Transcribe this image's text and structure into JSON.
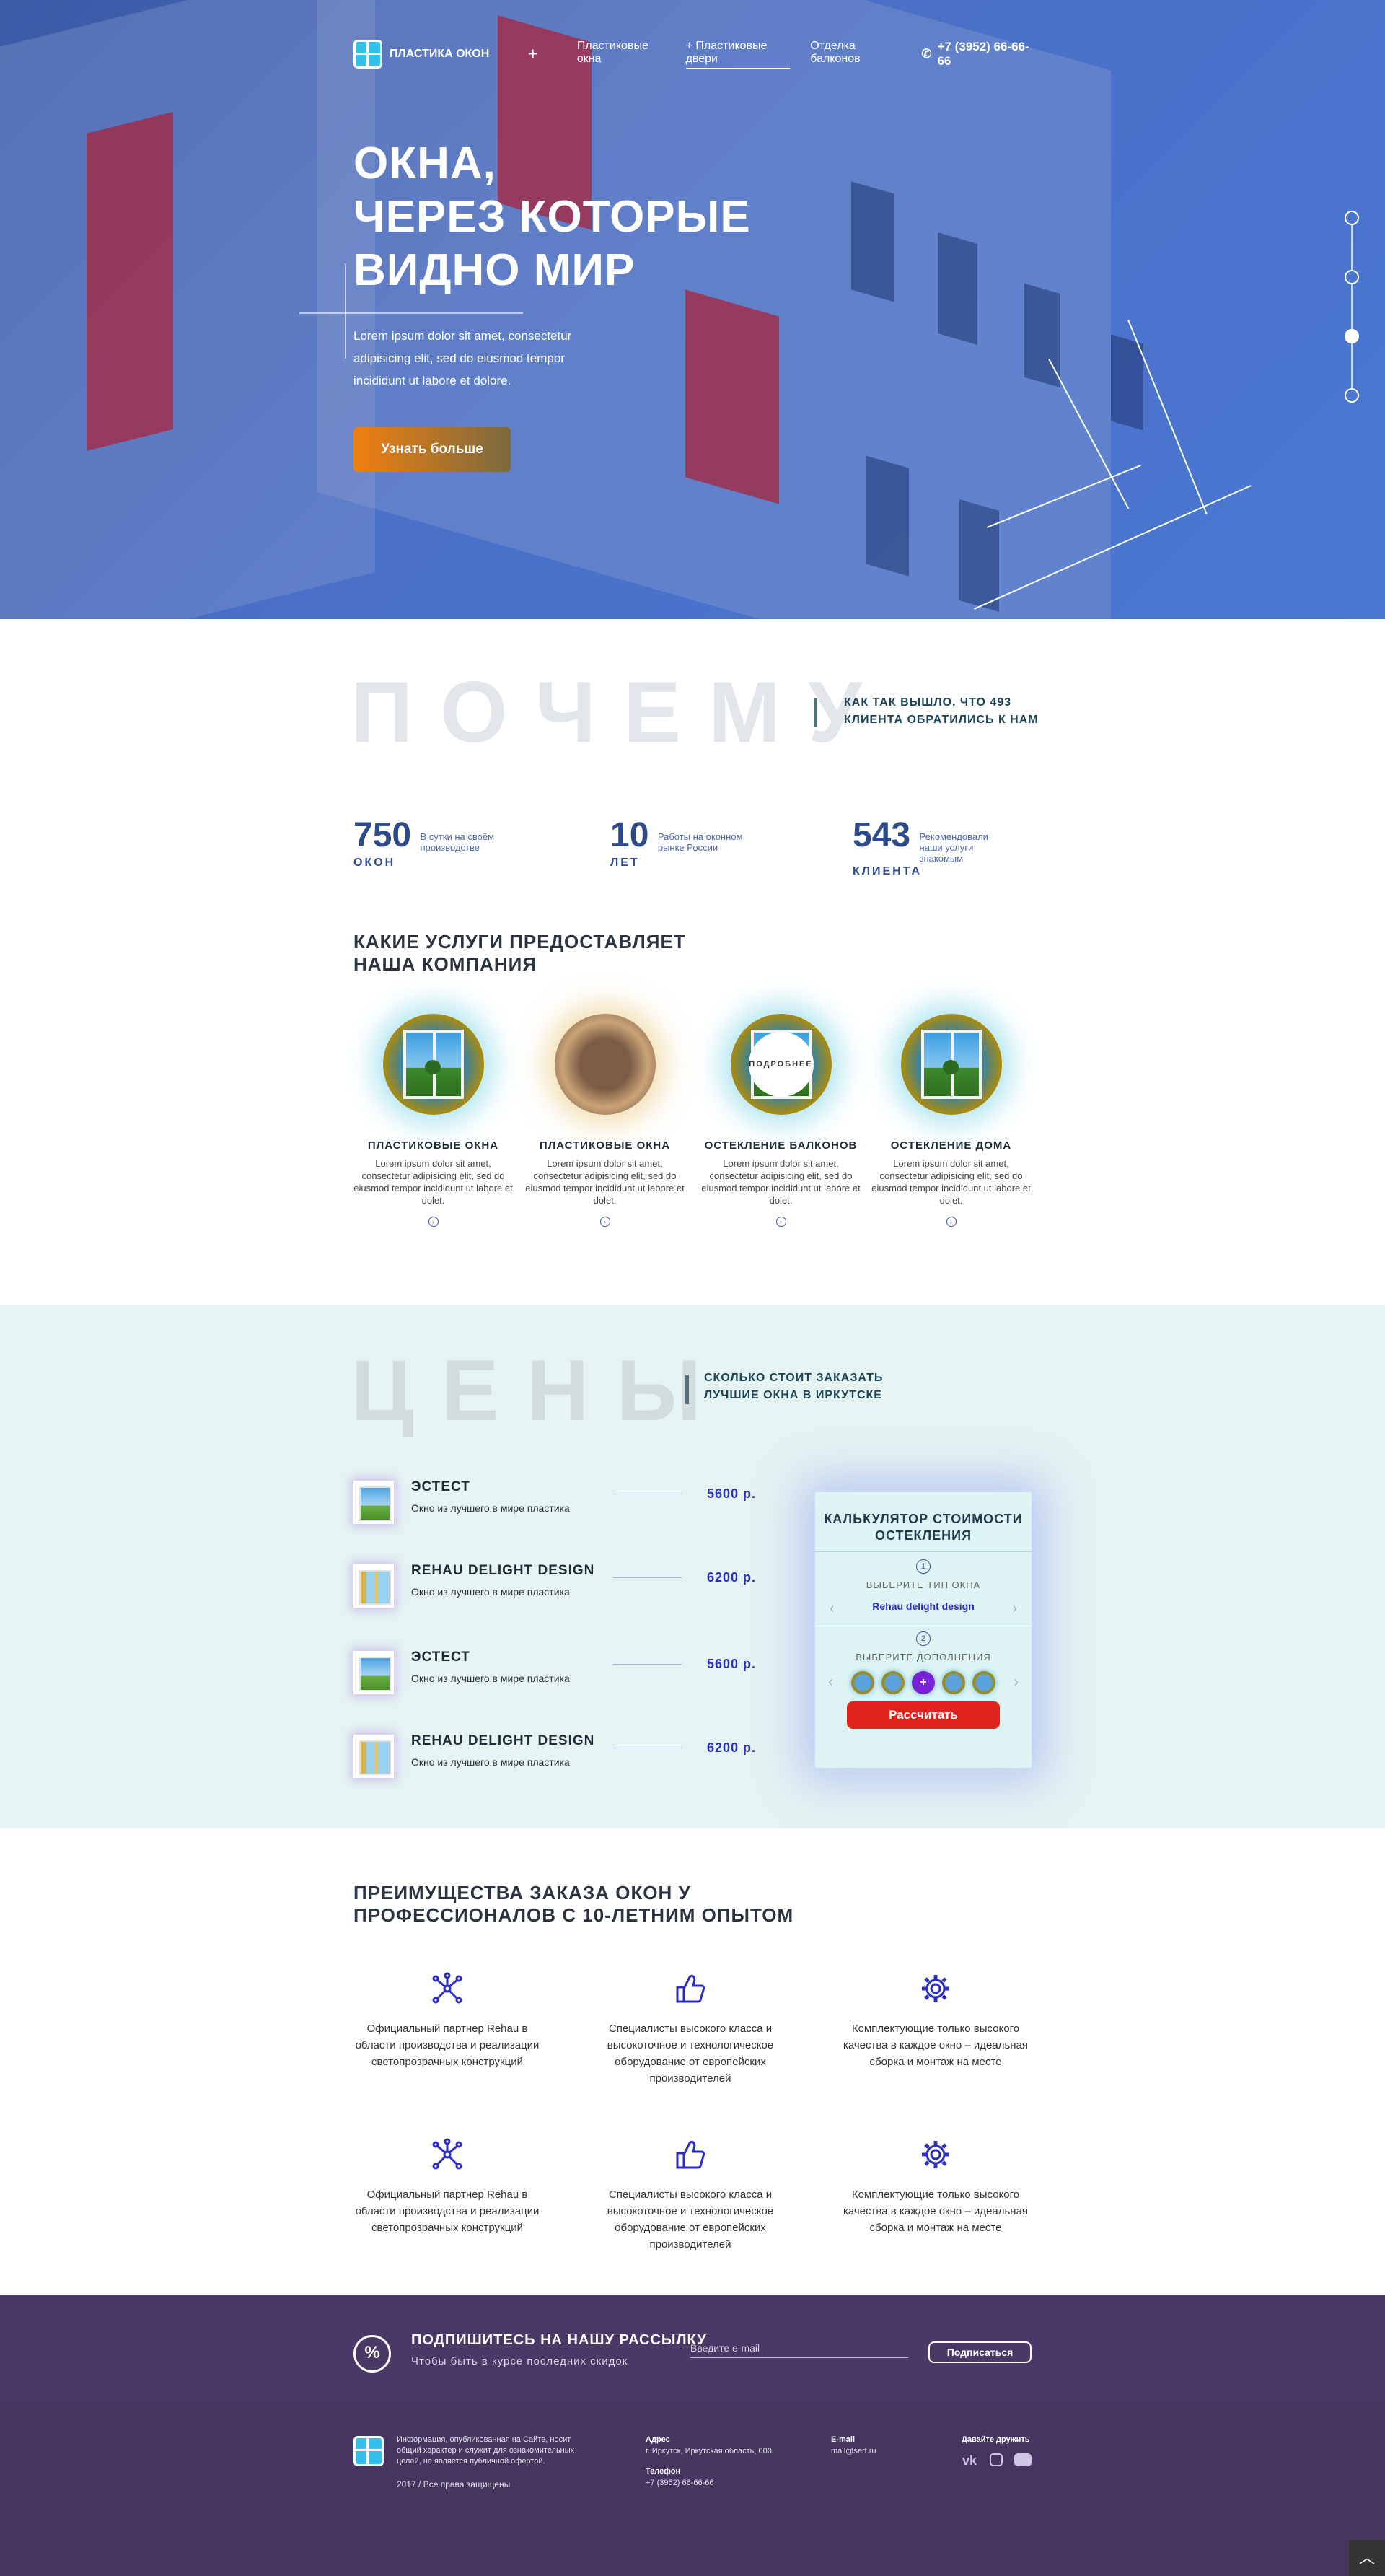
{
  "header": {
    "logo_text": "ПЛАСТИКА ОКОН",
    "plus": "+",
    "nav": [
      "Пластиковые окна",
      "+ Пластиковые двери",
      "Отделка балконов"
    ],
    "phone": "+7 (3952) 66-66-66"
  },
  "hero": {
    "title_l1": "ОКНА,",
    "title_l2": "ЧЕРЕЗ КОТОРЫЕ",
    "title_l3": "ВИДНО МИР",
    "lead": "Lorem ipsum dolor sit amet, consectetur adipisicing elit, sed do eiusmod tempor incididunt ut labore et dolore.",
    "cta": "Узнать больше",
    "slides_total": 4,
    "slide_active": 3
  },
  "why": {
    "big": "ПОЧЕМУ",
    "subtitle_l1": "КАК ТАК ВЫШЛО, ЧТО 493",
    "subtitle_l2": "КЛИЕНТА ОБРАТИЛИСЬ К НАМ",
    "stats": [
      {
        "num": "750",
        "small": "В сутки на своём производстве",
        "label": "ОКОН"
      },
      {
        "num": "10",
        "small": "Работы на оконном рынке России",
        "label": "ЛЕТ"
      },
      {
        "num": "543",
        "small": "Рекомендовали наши услуги знакомым",
        "label": "КЛИЕНТА"
      }
    ]
  },
  "services": {
    "title_l1": "КАКИЕ УСЛУГИ ПРЕДОСТАВЛЯЕТ",
    "title_l2": "НАША КОМПАНИЯ",
    "more": "ПОДРОБНЕЕ",
    "items": [
      {
        "title": "ПЛАСТИКОВЫЕ ОКНА",
        "desc": "Lorem ipsum dolor sit amet, consectetur adipisicing elit, sed do eiusmod tempor incididunt ut labore et dolet."
      },
      {
        "title": "ПЛАСТИКОВЫЕ ОКНА",
        "desc": "Lorem ipsum dolor sit amet, consectetur adipisicing elit, sed do eiusmod tempor incididunt ut labore et dolet."
      },
      {
        "title": "ОСТЕКЛЕНИЕ БАЛКОНОВ",
        "desc": "Lorem ipsum dolor sit amet, consectetur adipisicing elit, sed do eiusmod tempor incididunt ut labore et dolet."
      },
      {
        "title": "ОСТЕКЛЕНИЕ ДОМА",
        "desc": "Lorem ipsum dolor sit amet, consectetur adipisicing elit, sed do eiusmod tempor incididunt ut labore et dolet."
      }
    ]
  },
  "prices": {
    "big": "ЦЕНЫ",
    "subtitle_l1": "СКОЛЬКО СТОИТ ЗАКАЗАТЬ",
    "subtitle_l2": "ЛУЧШИЕ ОКНА В ИРКУТСКЕ",
    "items": [
      {
        "name": "ЭСТЕСТ",
        "desc": "Окно из лучшего в мире пластика",
        "price": "5600 р."
      },
      {
        "name": "REHAU DELIGHT DESIGN",
        "desc": "Окно из лучшего в мире пластика",
        "price": "6200 р."
      },
      {
        "name": "ЭСТЕСТ",
        "desc": "Окно из лучшего в мире пластика",
        "price": "5600 р."
      },
      {
        "name": "REHAU DELIGHT DESIGN",
        "desc": "Окно из лучшего в мире пластика",
        "price": "6200 р."
      }
    ]
  },
  "calc": {
    "title_l1": "КАЛЬКУЛЯТОР СТОИМОСТИ",
    "title_l2": "ОСТЕКЛЕНИЯ",
    "step1": "1",
    "step1_label": "ВЫБЕРИТЕ ТИП ОКНА",
    "step1_value": "Rehau delight design",
    "step2": "2",
    "step2_label": "ВЫБЕРИТЕ ДОПОЛНЕНИЯ",
    "selected_option": "+",
    "button": "Рассчитать"
  },
  "advantages": {
    "title_l1": "ПРЕИМУЩЕСТВА ЗАКАЗА ОКОН У",
    "title_l2": "ПРОФЕССИОНАЛОВ С 10-ЛЕТНИМ ОПЫТОМ",
    "items": [
      {
        "icon": "network-icon",
        "text": "Официальный партнер Rehau в области производства и реализации светопрозрачных конструкций"
      },
      {
        "icon": "thumbs-up-icon",
        "text": "Специалисты высокого класса и высокоточное и технологическое оборудование от европейских производителей"
      },
      {
        "icon": "gear-icon",
        "text": "Комплектующие только высокого качества в каждое окно – идеальная сборка и монтаж на месте"
      },
      {
        "icon": "network-icon",
        "text": "Официальный партнер Rehau в области производства и реализации светопрозрачных конструкций"
      },
      {
        "icon": "thumbs-up-icon",
        "text": "Специалисты высокого класса и высокоточное и технологическое оборудование от европейских производителей"
      },
      {
        "icon": "gear-icon",
        "text": "Комплектующие только высокого качества в каждое окно – идеальная сборка и монтаж на месте"
      }
    ]
  },
  "subscribe": {
    "title": "ПОДПИШИТЕСЬ НА НАШУ РАССЫЛКУ",
    "subtitle": "Чтобы быть в курсе последних скидок",
    "placeholder": "Введите e-mail",
    "button": "Подписаться"
  },
  "footer": {
    "info": "Информация, опубликованная на Сайте, носит общий характер и служит для ознакомительных целей, не является публичной офертой.",
    "copy": "2017 / Все права защищены",
    "address_label": "Адрес",
    "address": "г. Иркутск, Иркутская область, 000",
    "phone_label": "Телефон",
    "phone": "+7 (3952) 66-66-66",
    "email_label": "E-mail",
    "email": "mail@sert.ru",
    "social_label": "Давайте дружить",
    "social": [
      "vk-icon",
      "instagram-icon",
      "youtube-icon"
    ]
  },
  "colors": {
    "accent": "#2a2fc0",
    "cta": "#f07f10",
    "calc_button": "#e0231c",
    "footer": "#46365f"
  }
}
